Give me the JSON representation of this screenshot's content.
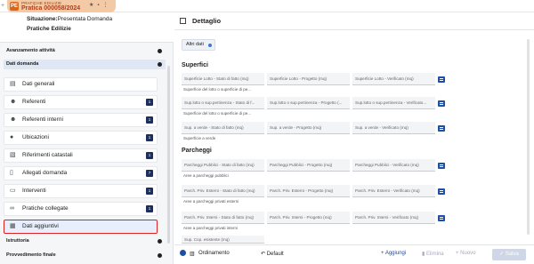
{
  "tab": {
    "subtitle": "PRATICHE EDILIZIE",
    "title": "Pratica 000058/2024",
    "logo": "PE"
  },
  "info": {
    "situazione_label": "Situazione:",
    "situazione_value": "Presentata Domanda",
    "tipo": "Pratiche Edilizie"
  },
  "sections": [
    {
      "label": "Avanzamento attività"
    },
    {
      "label": "Dati domanda"
    },
    {
      "label": "Istruttoria"
    },
    {
      "label": "Provvedimento finale"
    }
  ],
  "items": [
    {
      "label": "Dati generali",
      "icon": "document-icon",
      "badge": ""
    },
    {
      "label": "Referenti",
      "icon": "people-icon",
      "badge": "1"
    },
    {
      "label": "Referenti interni",
      "icon": "people-icon",
      "badge": "1"
    },
    {
      "label": "Ubicazioni",
      "icon": "pin-icon",
      "badge": "1"
    },
    {
      "label": "Riferimenti catastali",
      "icon": "map-icon",
      "badge": "1"
    },
    {
      "label": "Allegati domanda",
      "icon": "attachment-icon",
      "badge": "7"
    },
    {
      "label": "Interventi",
      "icon": "tool-icon",
      "badge": "1"
    },
    {
      "label": "Pratiche collegate",
      "icon": "link-icon",
      "badge": "1"
    },
    {
      "label": "Dati aggiuntivi",
      "icon": "calendar-icon",
      "badge": ""
    }
  ],
  "detail": {
    "title": "Dettaglio",
    "chip": "Altri dati",
    "groups": {
      "superfici": "Superfici",
      "parcheggi": "Parcheggi"
    },
    "rows": [
      {
        "fields": [
          "Superficie Lotto - Stato di fatto (mq)",
          "Superficie Lotto - Progetto (mq)",
          "Superficie Lotto - Verificato (mq)"
        ],
        "help": "Superficie del lotto o superficie di pe..."
      },
      {
        "fields": [
          "Sup.lotto o sup.pertinenza - Stato di f...",
          "Sup.lotto o sup.pertinenza - Progetto (...",
          "Sup.lotto o sup.pertinenza - Verificato..."
        ],
        "help": "Superficie del lotto o superficie di pe..."
      },
      {
        "fields": [
          "Sup. a verde - Stato di fatto (mq)",
          "Sup. a verde - Progetto (mq)",
          "Sup. a verde - Verificato (mq)"
        ],
        "help": "Superficie a verde"
      },
      {
        "fields": [
          "Parcheggi Pubblici - Stato di fatto (mq)",
          "Parcheggi Pubblici - Progetto (mq)",
          "Parcheggi Pubblici - Verificato (mq)"
        ],
        "help": "Aree a parcheggi pubblici"
      },
      {
        "fields": [
          "Parch. Priv. Esterni - Stato di fatto (mq)",
          "Parch. Priv. Esterni - Progetto (mq)",
          "Parch. Priv. Esterni - Verificato (mq)"
        ],
        "help": "Aree a parcheggi privati esterni"
      },
      {
        "fields": [
          "Parch. Priv. Interni - Stato di fatto (mq)",
          "Parch. Priv. Interni - Progetto (mq)",
          "Parch. Priv. Interni - Verificato (mq)"
        ],
        "help": "Aree a parcheggi privati interni"
      },
      {
        "fields": [
          "Sup. Cop. esistente (mq)"
        ],
        "help": ""
      }
    ]
  },
  "footer": {
    "ordinamento": "Ordinamento",
    "default": "Default",
    "aggiungi": "Aggiungi",
    "elimina": "Elimina",
    "nuovo": "Nuovo",
    "salva": "Salva"
  },
  "colors": {
    "accent": "#1d4ea8",
    "badge": "#1f2f5c",
    "highlight": "#dd2222"
  }
}
